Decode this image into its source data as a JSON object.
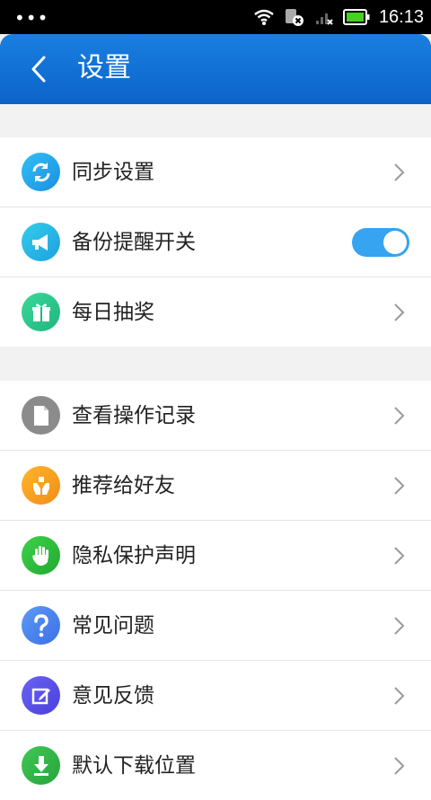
{
  "status": {
    "time": "16:13"
  },
  "header": {
    "title": "设置"
  },
  "groups": [
    {
      "items": [
        {
          "label": "同步设置",
          "icon": "sync-icon",
          "color": "#2aa6ea",
          "type": "link"
        },
        {
          "label": "备份提醒开关",
          "icon": "megaphone-icon",
          "color": "#24b3e6",
          "type": "toggle",
          "on": true
        },
        {
          "label": "每日抽奖",
          "icon": "gift-icon",
          "color": "#2cc98a",
          "type": "link"
        }
      ]
    },
    {
      "items": [
        {
          "label": "查看操作记录",
          "icon": "document-icon",
          "color": "#8b8b8b",
          "type": "link"
        },
        {
          "label": "推荐给好友",
          "icon": "share-hands-icon",
          "color": "#f3a21f",
          "type": "link"
        },
        {
          "label": "隐私保护声明",
          "icon": "hand-icon",
          "color": "#30c13a",
          "type": "link"
        },
        {
          "label": "常见问题",
          "icon": "question-icon",
          "color": "#4f86f0",
          "type": "link"
        },
        {
          "label": "意见反馈",
          "icon": "edit-icon",
          "color": "#5b55ea",
          "type": "link"
        },
        {
          "label": "默认下载位置",
          "icon": "download-icon",
          "color": "#34b84a",
          "type": "link"
        }
      ]
    }
  ]
}
